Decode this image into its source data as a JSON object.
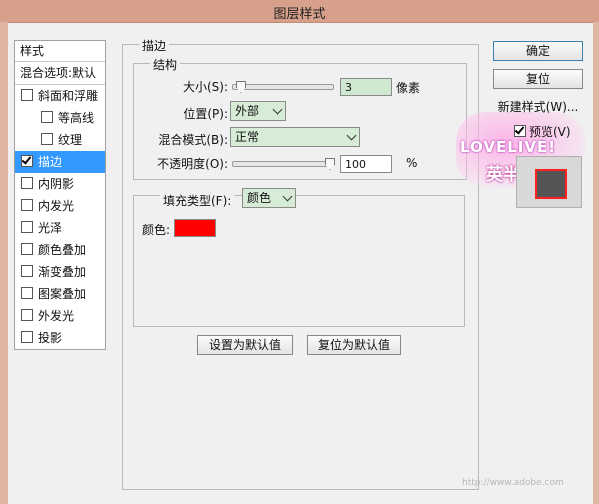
{
  "window": {
    "title": "图层样式"
  },
  "sidebar": {
    "header": "样式",
    "blending_options": "混合选项:默认",
    "items": [
      {
        "label": "斜面和浮雕",
        "checked": false,
        "sub": false,
        "selected": false
      },
      {
        "label": "等高线",
        "checked": false,
        "sub": true,
        "selected": false
      },
      {
        "label": "纹理",
        "checked": false,
        "sub": true,
        "selected": false
      },
      {
        "label": "描边",
        "checked": true,
        "sub": false,
        "selected": true
      },
      {
        "label": "内阴影",
        "checked": false,
        "sub": false,
        "selected": false
      },
      {
        "label": "内发光",
        "checked": false,
        "sub": false,
        "selected": false
      },
      {
        "label": "光泽",
        "checked": false,
        "sub": false,
        "selected": false
      },
      {
        "label": "颜色叠加",
        "checked": false,
        "sub": false,
        "selected": false
      },
      {
        "label": "渐变叠加",
        "checked": false,
        "sub": false,
        "selected": false
      },
      {
        "label": "图案叠加",
        "checked": false,
        "sub": false,
        "selected": false
      },
      {
        "label": "外发光",
        "checked": false,
        "sub": false,
        "selected": false
      },
      {
        "label": "投影",
        "checked": false,
        "sub": false,
        "selected": false
      }
    ]
  },
  "stroke": {
    "title": "描边",
    "structure": {
      "title": "结构",
      "size_label": "大小(S):",
      "size_value": "3",
      "size_unit": "像素",
      "size_level": 0.03,
      "position_label": "位置(P):",
      "position_value": "外部",
      "blend_mode_label": "混合模式(B):",
      "blend_mode_value": "正常",
      "opacity_label": "不透明度(O):",
      "opacity_value": "100",
      "opacity_unit": "%",
      "opacity_level": 1.0
    },
    "fill": {
      "type_label": "填充类型(F):",
      "type_value": "颜色",
      "color_label": "颜色:",
      "color": "#ff0000"
    },
    "make_default": "设置为默认值",
    "reset_default": "复位为默认值"
  },
  "right": {
    "ok": "确定",
    "reset": "复位",
    "new_style": "新建样式(W)...",
    "preview_label": "预览(V)",
    "preview_checked": true
  },
  "watermark": {
    "line1": "LOVELIVE!",
    "line2": "英半!简",
    "footer": "http://www.adobe.com"
  },
  "colors": {
    "titlebar": "#d6a08a",
    "selection": "#3399ff",
    "stroke_color": "#ff0000"
  }
}
